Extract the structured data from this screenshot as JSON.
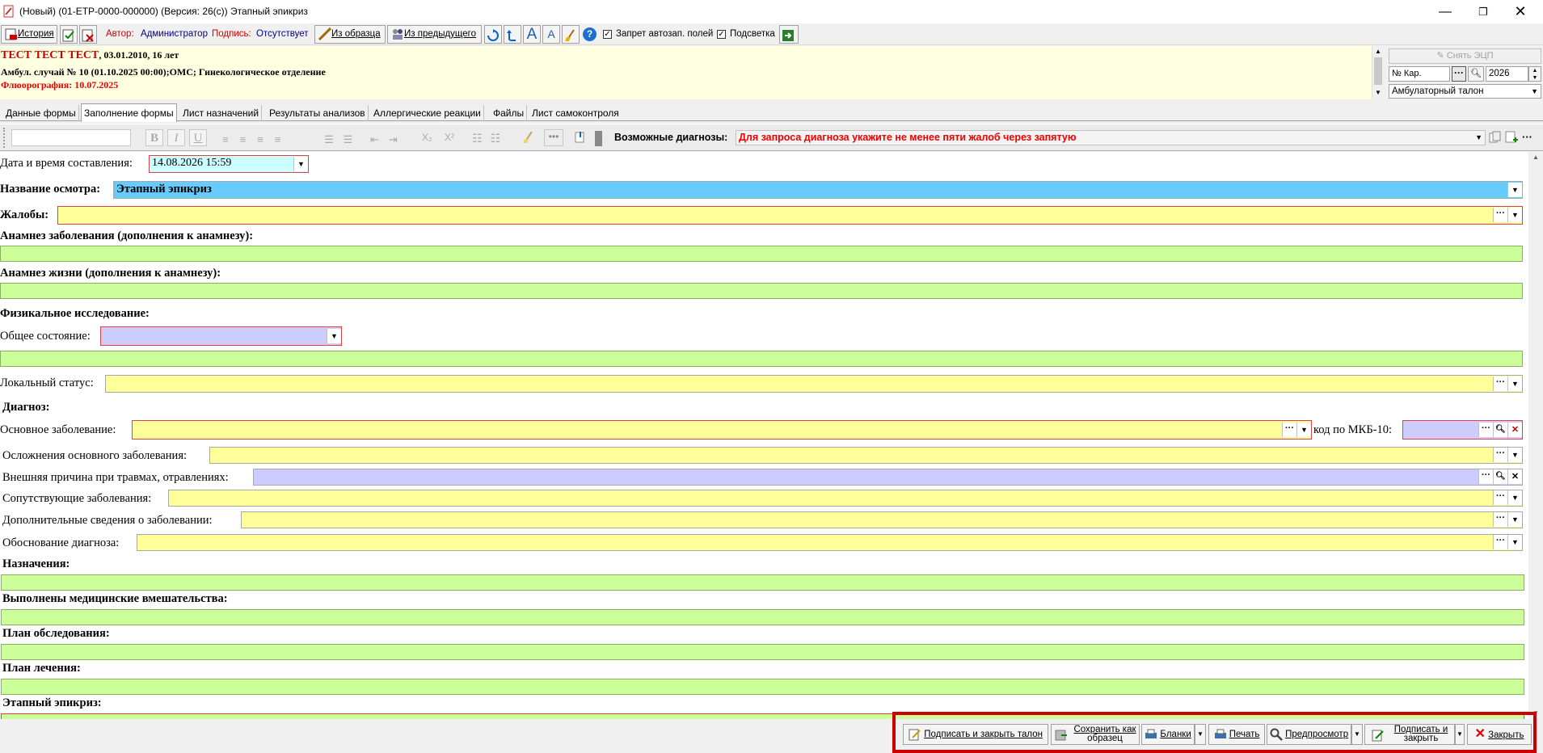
{
  "window": {
    "title": "(Новый) (01-ЕТР-0000-000000) (Версия: 26(с)) Этапный эпикриз"
  },
  "toolbar": {
    "history_label": "История",
    "author_label": "Автор:",
    "author_value": "Администратор",
    "sign_label": "Подпись:",
    "sign_value": "Отсутствует",
    "from_sample_label": "Из образца",
    "from_prev_label": "Из предыдущего",
    "autofill_ban_label": "Запрет автозап. полей",
    "highlight_label": "Подсветка"
  },
  "patient": {
    "name": "ТЕСТ ТЕСТ ТЕСТ",
    "dob": ", 03.01.2010, 16 лет",
    "case_line": "Амбул. случай  № 10 (01.10.2025 00:00);ОМС; Гинекологическое отделение",
    "fluoro": "Флюорография: 10.07.2025"
  },
  "rightpanel": {
    "remove_signature": "Снять ЭЦП",
    "card_placeholder": "№ Кар.",
    "year": "2026",
    "talon_type": "Амбулаторный талон"
  },
  "tabs": [
    "Данные формы",
    "Заполнение формы",
    "Лист назначений",
    "Результаты анализов",
    "Аллергические реакции",
    "Файлы",
    "Лист самоконтроля"
  ],
  "format": {
    "bold": "B",
    "italic": "I",
    "underline": "U",
    "sub": "X₂",
    "sup": "X²",
    "diag_label": "Возможные диагнозы:",
    "diag_hint": "Для запроса диагноза укажите не менее пяти жалоб через запятую"
  },
  "form": {
    "datetime_label": "Дата и время составления:",
    "datetime_value": "14.08.2026 15:59",
    "exam_name_label": "Название осмотра:",
    "exam_name_value": "Этапный эпикриз",
    "complaints_label": "Жалобы:",
    "anamnesis_disease_label": "Анамнез заболевания (дополнения к анамнезу):",
    "anamnesis_life_label": "Анамнез жизни (дополнения к анамнезу):",
    "physical_label": "Физикальное исследование:",
    "general_state_label": "Общее состояние:",
    "local_status_label": "Локальный статус:",
    "diagnosis_label": "Диагноз:",
    "main_disease_label": "Основное заболевание:",
    "mkb_label": "код по МКБ-10:",
    "complications_label": "Осложнения основного заболевания:",
    "external_cause_label": "Внешняя причина при травмах, отравлениях:",
    "concomitant_label": "Сопутствующие заболевания:",
    "additional_label": "Дополнительные сведения о заболевании:",
    "justification_label": "Обоснование диагноза:",
    "prescriptions_label": "Назначения:",
    "interventions_label": "Выполнены медицинские вмешательства:",
    "exam_plan_label": "План обследования:",
    "treatment_plan_label": "План лечения:",
    "epicrisis_label": "Этапный эпикриз:"
  },
  "bottom": {
    "sign_close_talon": "Подписать и закрыть талон",
    "save_as_sample_1": "Сохранить как",
    "save_as_sample_2": "образец",
    "blanks": "Бланки",
    "print": "Печать",
    "preview": "Предпросмотр",
    "sign_close_1": "Подписать и",
    "sign_close_2": "закрыть",
    "close": "Закрыть"
  }
}
